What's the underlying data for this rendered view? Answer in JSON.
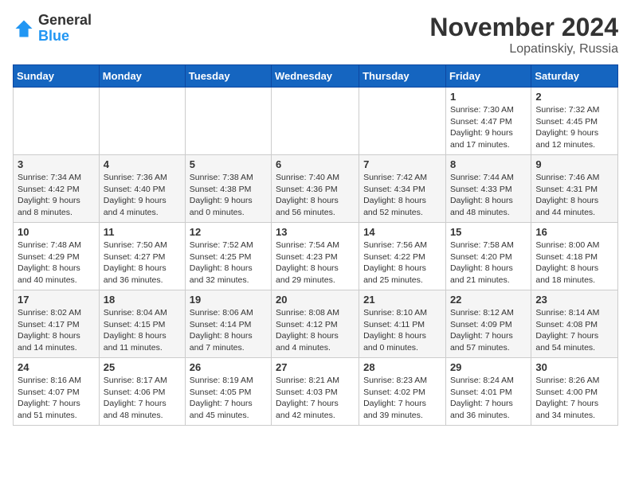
{
  "logo": {
    "general": "General",
    "blue": "Blue"
  },
  "title": "November 2024",
  "location": "Lopatinskiy, Russia",
  "days_of_week": [
    "Sunday",
    "Monday",
    "Tuesday",
    "Wednesday",
    "Thursday",
    "Friday",
    "Saturday"
  ],
  "weeks": [
    [
      {
        "day": "",
        "info": ""
      },
      {
        "day": "",
        "info": ""
      },
      {
        "day": "",
        "info": ""
      },
      {
        "day": "",
        "info": ""
      },
      {
        "day": "",
        "info": ""
      },
      {
        "day": "1",
        "info": "Sunrise: 7:30 AM\nSunset: 4:47 PM\nDaylight: 9 hours and 17 minutes."
      },
      {
        "day": "2",
        "info": "Sunrise: 7:32 AM\nSunset: 4:45 PM\nDaylight: 9 hours and 12 minutes."
      }
    ],
    [
      {
        "day": "3",
        "info": "Sunrise: 7:34 AM\nSunset: 4:42 PM\nDaylight: 9 hours and 8 minutes."
      },
      {
        "day": "4",
        "info": "Sunrise: 7:36 AM\nSunset: 4:40 PM\nDaylight: 9 hours and 4 minutes."
      },
      {
        "day": "5",
        "info": "Sunrise: 7:38 AM\nSunset: 4:38 PM\nDaylight: 9 hours and 0 minutes."
      },
      {
        "day": "6",
        "info": "Sunrise: 7:40 AM\nSunset: 4:36 PM\nDaylight: 8 hours and 56 minutes."
      },
      {
        "day": "7",
        "info": "Sunrise: 7:42 AM\nSunset: 4:34 PM\nDaylight: 8 hours and 52 minutes."
      },
      {
        "day": "8",
        "info": "Sunrise: 7:44 AM\nSunset: 4:33 PM\nDaylight: 8 hours and 48 minutes."
      },
      {
        "day": "9",
        "info": "Sunrise: 7:46 AM\nSunset: 4:31 PM\nDaylight: 8 hours and 44 minutes."
      }
    ],
    [
      {
        "day": "10",
        "info": "Sunrise: 7:48 AM\nSunset: 4:29 PM\nDaylight: 8 hours and 40 minutes."
      },
      {
        "day": "11",
        "info": "Sunrise: 7:50 AM\nSunset: 4:27 PM\nDaylight: 8 hours and 36 minutes."
      },
      {
        "day": "12",
        "info": "Sunrise: 7:52 AM\nSunset: 4:25 PM\nDaylight: 8 hours and 32 minutes."
      },
      {
        "day": "13",
        "info": "Sunrise: 7:54 AM\nSunset: 4:23 PM\nDaylight: 8 hours and 29 minutes."
      },
      {
        "day": "14",
        "info": "Sunrise: 7:56 AM\nSunset: 4:22 PM\nDaylight: 8 hours and 25 minutes."
      },
      {
        "day": "15",
        "info": "Sunrise: 7:58 AM\nSunset: 4:20 PM\nDaylight: 8 hours and 21 minutes."
      },
      {
        "day": "16",
        "info": "Sunrise: 8:00 AM\nSunset: 4:18 PM\nDaylight: 8 hours and 18 minutes."
      }
    ],
    [
      {
        "day": "17",
        "info": "Sunrise: 8:02 AM\nSunset: 4:17 PM\nDaylight: 8 hours and 14 minutes."
      },
      {
        "day": "18",
        "info": "Sunrise: 8:04 AM\nSunset: 4:15 PM\nDaylight: 8 hours and 11 minutes."
      },
      {
        "day": "19",
        "info": "Sunrise: 8:06 AM\nSunset: 4:14 PM\nDaylight: 8 hours and 7 minutes."
      },
      {
        "day": "20",
        "info": "Sunrise: 8:08 AM\nSunset: 4:12 PM\nDaylight: 8 hours and 4 minutes."
      },
      {
        "day": "21",
        "info": "Sunrise: 8:10 AM\nSunset: 4:11 PM\nDaylight: 8 hours and 0 minutes."
      },
      {
        "day": "22",
        "info": "Sunrise: 8:12 AM\nSunset: 4:09 PM\nDaylight: 7 hours and 57 minutes."
      },
      {
        "day": "23",
        "info": "Sunrise: 8:14 AM\nSunset: 4:08 PM\nDaylight: 7 hours and 54 minutes."
      }
    ],
    [
      {
        "day": "24",
        "info": "Sunrise: 8:16 AM\nSunset: 4:07 PM\nDaylight: 7 hours and 51 minutes."
      },
      {
        "day": "25",
        "info": "Sunrise: 8:17 AM\nSunset: 4:06 PM\nDaylight: 7 hours and 48 minutes."
      },
      {
        "day": "26",
        "info": "Sunrise: 8:19 AM\nSunset: 4:05 PM\nDaylight: 7 hours and 45 minutes."
      },
      {
        "day": "27",
        "info": "Sunrise: 8:21 AM\nSunset: 4:03 PM\nDaylight: 7 hours and 42 minutes."
      },
      {
        "day": "28",
        "info": "Sunrise: 8:23 AM\nSunset: 4:02 PM\nDaylight: 7 hours and 39 minutes."
      },
      {
        "day": "29",
        "info": "Sunrise: 8:24 AM\nSunset: 4:01 PM\nDaylight: 7 hours and 36 minutes."
      },
      {
        "day": "30",
        "info": "Sunrise: 8:26 AM\nSunset: 4:00 PM\nDaylight: 7 hours and 34 minutes."
      }
    ]
  ]
}
